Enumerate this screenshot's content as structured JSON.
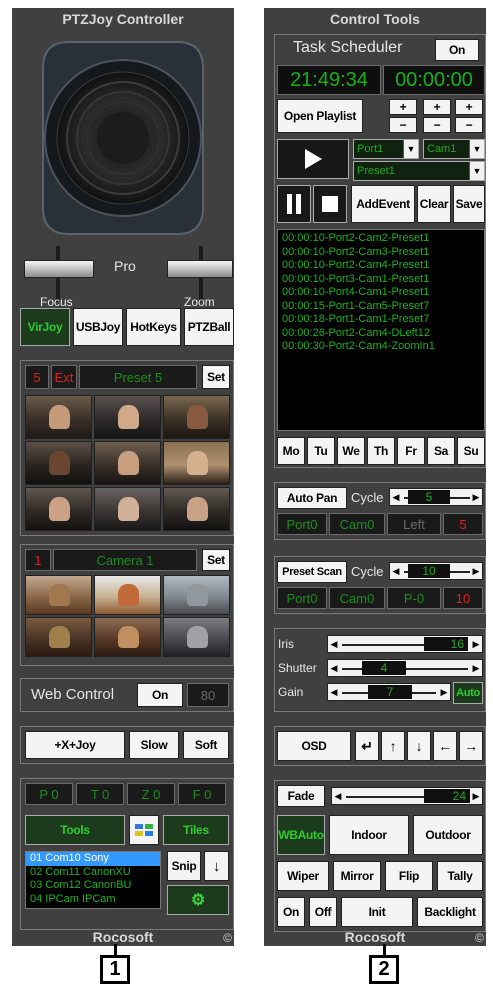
{
  "left": {
    "title": "PTZJoy Controller",
    "joystick": {
      "pro_label": "Pro",
      "focus_label": "Focus",
      "zoom_label": "Zoom"
    },
    "mode_buttons": [
      "VirJoy",
      "USBJoy",
      "HotKeys",
      "PTZBall"
    ],
    "preset_bar": {
      "number": "5",
      "ext": "Ext",
      "name": "Preset 5",
      "set_label": "Set"
    },
    "camera_bar": {
      "number": "1",
      "name": "Camera 1",
      "set_label": "Set"
    },
    "web_control": {
      "label": "Web Control",
      "on_label": "On",
      "port": "80"
    },
    "joy_row": {
      "joy_label": "+X+Joy",
      "slow_label": "Slow",
      "soft_label": "Soft"
    },
    "ptzf": [
      "P 0",
      "T 0",
      "Z 0",
      "F 0"
    ],
    "tools_label": "Tools",
    "tiles_label": "Tiles",
    "snip_label": "Snip",
    "cameras": [
      "01 Com10 Sony",
      "02 Com11 CanonXU",
      "03 Com12 CanonBU",
      "04 IPCam IPCam"
    ],
    "footer": "Rocosoft",
    "copyright": "©"
  },
  "right": {
    "title": "Control Tools",
    "scheduler": {
      "title": "Task Scheduler",
      "on_label": "On",
      "clock": "21:49:34",
      "timer": "00:00:00",
      "open_playlist_label": "Open Playlist",
      "plus": "+",
      "minus": "−",
      "port_value": "Port1",
      "cam_value": "Cam1",
      "preset_value": "Preset1",
      "add_event_label": "AddEvent",
      "clear_label": "Clear",
      "save_label": "Save",
      "events": [
        "00:00:10-Port2-Cam2-Preset1",
        "00:00:10-Port2-Cam3-Preset1",
        "00:00:10-Port2-Cam4-Preset1",
        "00:00:10-Port3-Cam1-Preset1",
        "00:00:10-Port4-Cam1-Preset1",
        "00:00:15-Port1-Cam5-Preset7",
        "00:00:18-Port1-Cam1-Preset7",
        "00:00:26-Port2-Cam4-DLeft12",
        "00:00:30-Port2-Cam4-ZoomIn1"
      ],
      "days": [
        "Mo",
        "Tu",
        "We",
        "Th",
        "Fr",
        "Sa",
        "Su"
      ]
    },
    "auto_pan": {
      "label": "Auto Pan",
      "cycle_label": "Cycle",
      "cycle_value": "5",
      "port": "Port0",
      "cam": "Cam0",
      "dir": "Left",
      "count": "5"
    },
    "preset_scan": {
      "label": "Preset Scan",
      "cycle_label": "Cycle",
      "cycle_value": "10",
      "port": "Port0",
      "cam": "Cam0",
      "preset": "P-0",
      "count": "10"
    },
    "iris": {
      "label": "Iris",
      "value": "16"
    },
    "shutter": {
      "label": "Shutter",
      "value": "4"
    },
    "gain": {
      "label": "Gain",
      "value": "7",
      "auto_label": "Auto"
    },
    "osd_label": "OSD",
    "fade": {
      "label": "Fade",
      "value": "24"
    },
    "wb_auto_label": "WBAuto",
    "indoor_label": "Indoor",
    "outdoor_label": "Outdoor",
    "wiper_label": "Wiper",
    "mirror_label": "Mirror",
    "flip_label": "Flip",
    "tally_label": "Tally",
    "on_label": "On",
    "off_label": "Off",
    "init_label": "Init",
    "backlight_label": "Backlight",
    "footer": "Rocosoft",
    "copyright": "©"
  },
  "callouts": [
    "1",
    "2"
  ]
}
